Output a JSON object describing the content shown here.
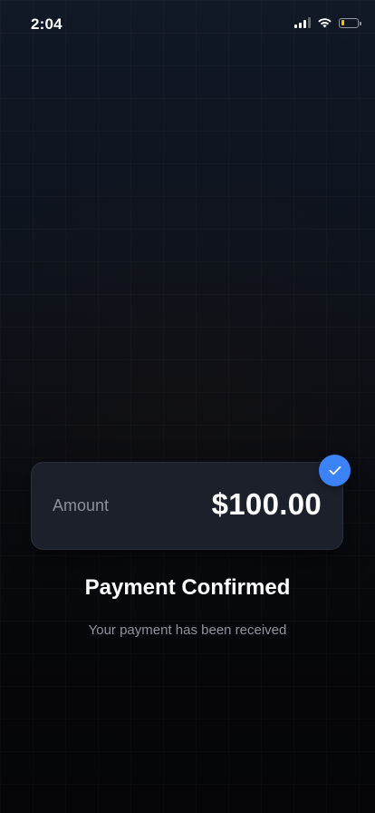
{
  "status_bar": {
    "time": "2:04",
    "icons": [
      "signal-icon",
      "wifi-icon",
      "battery-icon"
    ],
    "battery_level": 0.2,
    "battery_color": "#f5c400"
  },
  "payment": {
    "amount_label": "Amount",
    "amount_value": "$100.00",
    "status_icon": "checkmark-icon",
    "accent_color": "#3b82f6",
    "title": "Payment Confirmed",
    "subtitle": "Your payment has been received"
  }
}
